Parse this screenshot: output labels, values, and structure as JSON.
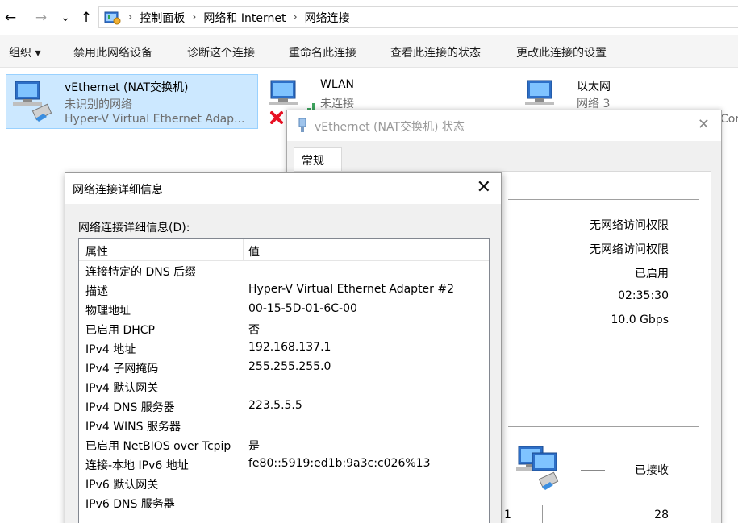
{
  "nav": {
    "back_glyph": "←",
    "forward_glyph": "→",
    "recent_glyph": "⌄",
    "up_glyph": "↑"
  },
  "address": {
    "icon": "control-panel-icon",
    "crumbs": [
      "控制面板",
      "网络和 Internet",
      "网络连接"
    ],
    "separator": "›"
  },
  "toolbar": {
    "organize": "组织 ▾",
    "disable": "禁用此网络设备",
    "diagnose": "诊断这个连接",
    "rename": "重命名此连接",
    "view_status": "查看此连接的状态",
    "change_settings": "更改此连接的设置"
  },
  "connections": [
    {
      "name": "vEthernet (NAT交换机)",
      "status": "未识别的网络",
      "device": "Hyper-V Virtual Ethernet Adap...",
      "icon": "network-adapter-icon"
    },
    {
      "name": "WLAN",
      "status": "未连接",
      "device": "",
      "icon": "wifi-adapter-disconnected-icon"
    },
    {
      "name": "以太网",
      "status": "网络 3",
      "device": "",
      "icon": "ethernet-adapter-icon"
    }
  ],
  "edge_fragment": "Cor",
  "status_dialog": {
    "title": "vEthernet (NAT交换机) 状态",
    "tab": "常规",
    "values": [
      "无网络访问权限",
      "无网络访问权限",
      "已启用",
      "02:35:30",
      "10.0 Gbps"
    ],
    "activity_label": "已接收",
    "bottom_left_digit": "1",
    "bottom_value": "28"
  },
  "details_dialog": {
    "title": "网络连接详细信息",
    "label": "网络连接详细信息(D):",
    "col_property": "属性",
    "col_value": "值",
    "rows": [
      {
        "k": "连接特定的 DNS 后缀",
        "v": ""
      },
      {
        "k": "描述",
        "v": "Hyper-V Virtual Ethernet Adapter #2"
      },
      {
        "k": "物理地址",
        "v": "00-15-5D-01-6C-00"
      },
      {
        "k": "已启用 DHCP",
        "v": "否"
      },
      {
        "k": "IPv4 地址",
        "v": "192.168.137.1"
      },
      {
        "k": "IPv4 子网掩码",
        "v": "255.255.255.0"
      },
      {
        "k": "IPv4 默认网关",
        "v": ""
      },
      {
        "k": "IPv4 DNS 服务器",
        "v": "223.5.5.5"
      },
      {
        "k": "IPv4 WINS 服务器",
        "v": ""
      },
      {
        "k": "已启用 NetBIOS over Tcpip",
        "v": "是"
      },
      {
        "k": "连接-本地 IPv6 地址",
        "v": "fe80::5919:ed1b:9a3c:c026%13"
      },
      {
        "k": "IPv6 默认网关",
        "v": ""
      },
      {
        "k": "IPv6 DNS 服务器",
        "v": ""
      }
    ]
  },
  "colors": {
    "selected_tile": "#cce8ff",
    "selected_border": "#99d1ff",
    "dialog_bg": "#f0f0f0",
    "error_red": "#e81123"
  }
}
